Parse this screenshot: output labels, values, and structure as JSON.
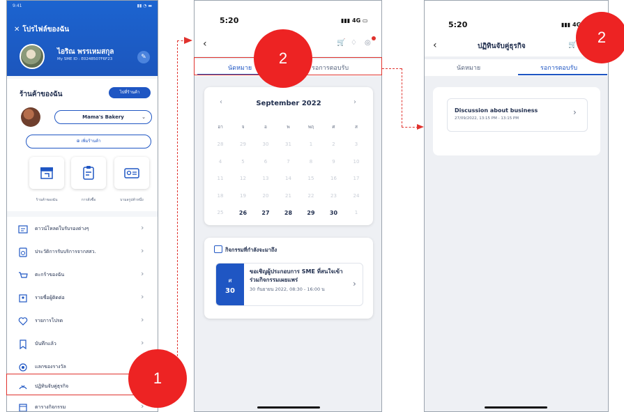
{
  "phone1": {
    "status_time": "9:41",
    "title": "โปรไฟล์ของฉัน",
    "user_name": "ไอริณ พรรเหมสกุล",
    "user_id": "My SME ID : E0248507F6F23",
    "shop_title": "ร้านค้าของฉัน",
    "go_shop_label": "ไปที่ร้านค้า",
    "shop_select_value": "Mama's Bakery",
    "add_shop_label": "เพิ่มร้านค้า",
    "tiles": [
      "ร้านค้าของฉัน",
      "การสั่งซื้อ",
      "บามลรูปค้าหนึ่ง"
    ],
    "menu": [
      {
        "label": "ดาวน์โหลดใบรับรองต่างๆ",
        "icon": "download-certificate-icon"
      },
      {
        "label": "ประวัติการรับบริการจากสสว.",
        "icon": "history-icon"
      },
      {
        "label": "ตะกร้าของฉัน",
        "icon": "cart-icon"
      },
      {
        "label": "รายชื่อผู้ติดต่อ",
        "icon": "contact-icon"
      },
      {
        "label": "รายการโปรด",
        "icon": "heart-icon"
      },
      {
        "label": "บันทึกแล้ว",
        "icon": "bookmark-icon"
      },
      {
        "label": "แลกของรางวัล",
        "icon": "reward-icon"
      },
      {
        "label": "ปฏิทินจับคู่ธุรกิจ",
        "icon": "business-calendar-icon"
      },
      {
        "label": "ตารางกิจกรรม",
        "icon": "activity-calendar-icon"
      }
    ]
  },
  "phone2": {
    "status_time": "5:20",
    "signal": "4G",
    "title": "ปฏิทินจับคู่ธุรกิจ",
    "header_visible": "จ",
    "tabs": [
      "นัดหมาย",
      "รอการตอบรับ"
    ],
    "calendar": {
      "month_label": "September 2022",
      "weekdays": [
        "อา",
        "จ",
        "อ",
        "พ",
        "พฤ",
        "ศ",
        "ส"
      ],
      "weeks": [
        [
          "28",
          "29",
          "30",
          "31",
          "1",
          "2",
          "3"
        ],
        [
          "4",
          "5",
          "6",
          "7",
          "8",
          "9",
          "10"
        ],
        [
          "11",
          "12",
          "13",
          "14",
          "15",
          "16",
          "17"
        ],
        [
          "18",
          "19",
          "20",
          "21",
          "22",
          "23",
          "24"
        ],
        [
          "25",
          "26",
          "27",
          "28",
          "29",
          "30",
          "1"
        ]
      ],
      "highlighted": [
        "26",
        "27",
        "28",
        "29",
        "30"
      ]
    },
    "events_title": "กิจกรรมที่กำลังจะมาถึง",
    "event": {
      "day_short": "ศ",
      "day_num": "30",
      "title": "ขอเชิญผู้ประกอบการ SME ที่สนใจเข้าร่วมกิจกรรมเผยแพร่",
      "time": "30 กันยายน 2022, 08:30 - 16:00 น"
    }
  },
  "phone3": {
    "status_time": "5:20",
    "signal": "4G",
    "title": "ปฏิทินจับคู่ธุรกิจ",
    "tabs": [
      "นัดหมาย",
      "รอการตอบรับ"
    ],
    "card_title": "Discussion about business",
    "card_time": "27/09/2022, 13:15 PM - 13:15 PM"
  },
  "callouts": [
    "1",
    "2",
    "2"
  ],
  "colors": {
    "brand": "#1f56c3",
    "callout": "#ed2323"
  }
}
